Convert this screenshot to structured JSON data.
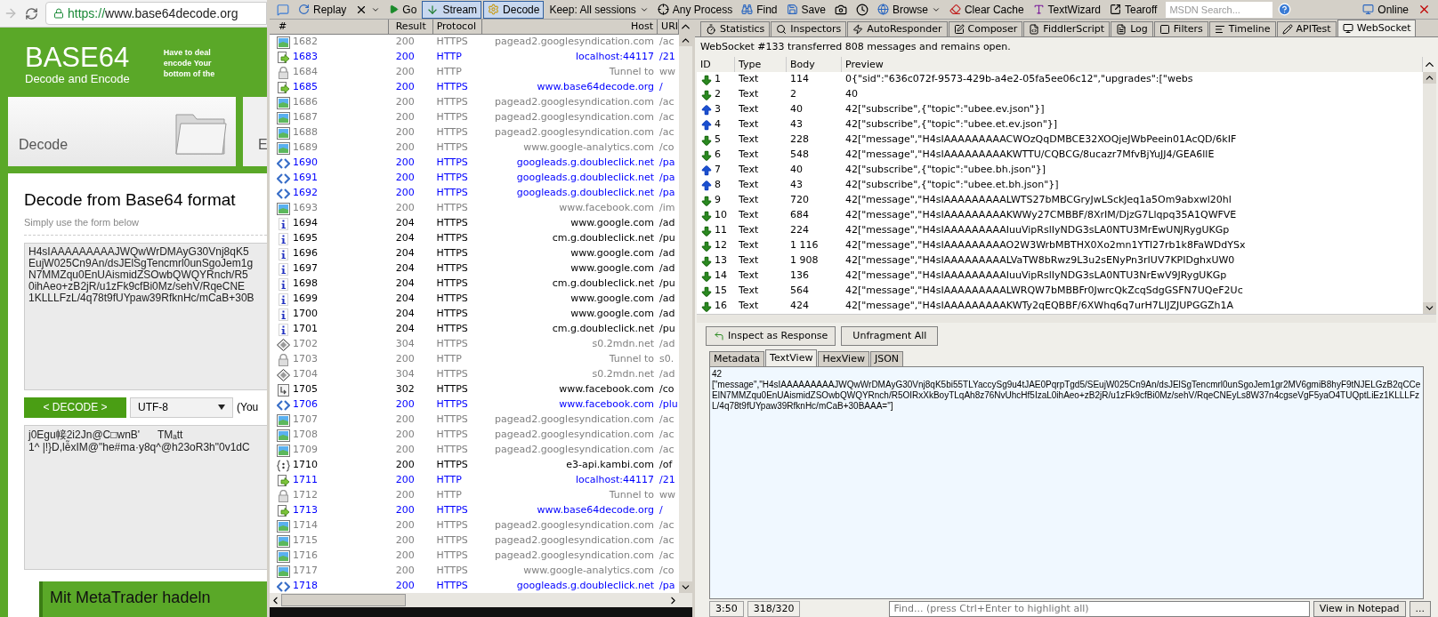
{
  "browser": {
    "url": "https://www.base64decode.org",
    "logo_title": "BASE64",
    "logo_subtitle": "Decode and Encode",
    "intro_lines": [
      "Have to deal",
      "encode Your",
      "bottom of the"
    ],
    "cards": [
      {
        "label": "Decode",
        "selected": true
      },
      {
        "label": "E",
        "selected": false
      }
    ],
    "heading": "Decode from Base64 format",
    "subheading": "Simply use the form below",
    "input_lines": [
      "H4sIAAAAAAAAAJWQwWrDMAyG30Vnj8qK5",
      "EujW025Cn9An/dsJElSgTencmrl0unSgoJem1g",
      "N7MMZqu0EnUAismidZSOwbQWQYRnch/R5",
      "0ihAeo+zB2jR/u1zFk9cfBi0Mz/sehV/RqeCNE",
      "1KLLLFzL/4q78t9fUYpaw39RfknHc/mCaB+30B"
    ],
    "decode_button": "< DECODE >",
    "charset": "UTF-8",
    "charset_note": "(You",
    "output_lines": [
      "j0Egu帹2i2Jn@C□wnB'      TMₐtt",
      "1^ |!}D,lễxIM@\"he#ma·y8q^@h23oR3h\"0v1dC"
    ],
    "banner": "Mit MetaTrader hadeln"
  },
  "toolbar": {
    "replay": "Replay",
    "go": "Go",
    "stream": {
      "label": "Stream",
      "on": true
    },
    "decode": {
      "label": "Decode",
      "on": true
    },
    "keep": "Keep: All sessions",
    "process": "Any Process",
    "find": "Find",
    "save": "Save",
    "browse": "Browse",
    "clear_cache": "Clear Cache",
    "text_wizard": "TextWizard",
    "tearoff": "Tearoff",
    "search_placeholder": "MSDN Search...",
    "online": "Online"
  },
  "sessions": {
    "columns": [
      "#",
      "Result",
      "Protocol",
      "Host",
      "URI"
    ],
    "rows": [
      {
        "num": "1682",
        "result": "200",
        "protocol": "HTTPS",
        "host": "pagead2.googlesyndication.com",
        "url": "/ac",
        "kind": "image",
        "color": "#808080"
      },
      {
        "num": "1683",
        "result": "200",
        "protocol": "HTTP",
        "host": "localhost:44117",
        "url": "/21",
        "kind": "script",
        "color": "#0000ff"
      },
      {
        "num": "1684",
        "result": "200",
        "protocol": "HTTP",
        "host": "Tunnel to",
        "url": "ww",
        "kind": "lock",
        "color": "#808080"
      },
      {
        "num": "1685",
        "result": "200",
        "protocol": "HTTPS",
        "host": "www.base64decode.org",
        "url": "/",
        "kind": "script",
        "color": "#0000ff"
      },
      {
        "num": "1686",
        "result": "200",
        "protocol": "HTTPS",
        "host": "pagead2.googlesyndication.com",
        "url": "/ac",
        "kind": "image",
        "color": "#808080"
      },
      {
        "num": "1687",
        "result": "200",
        "protocol": "HTTPS",
        "host": "pagead2.googlesyndication.com",
        "url": "/ac",
        "kind": "image",
        "color": "#808080"
      },
      {
        "num": "1688",
        "result": "200",
        "protocol": "HTTPS",
        "host": "pagead2.googlesyndication.com",
        "url": "/ac",
        "kind": "image",
        "color": "#808080"
      },
      {
        "num": "1689",
        "result": "200",
        "protocol": "HTTPS",
        "host": "www.google-analytics.com",
        "url": "/co",
        "kind": "image",
        "color": "#808080"
      },
      {
        "num": "1690",
        "result": "200",
        "protocol": "HTTPS",
        "host": "googleads.g.doubleclick.net",
        "url": "/pa",
        "kind": "html",
        "color": "#0000ff"
      },
      {
        "num": "1691",
        "result": "200",
        "protocol": "HTTPS",
        "host": "googleads.g.doubleclick.net",
        "url": "/pa",
        "kind": "html",
        "color": "#0000ff"
      },
      {
        "num": "1692",
        "result": "200",
        "protocol": "HTTPS",
        "host": "googleads.g.doubleclick.net",
        "url": "/pa",
        "kind": "html",
        "color": "#0000ff"
      },
      {
        "num": "1693",
        "result": "200",
        "protocol": "HTTPS",
        "host": "www.facebook.com",
        "url": "/im",
        "kind": "image",
        "color": "#808080"
      },
      {
        "num": "1694",
        "result": "204",
        "protocol": "HTTPS",
        "host": "www.google.com",
        "url": "/ad",
        "kind": "info",
        "color": "#000000"
      },
      {
        "num": "1695",
        "result": "204",
        "protocol": "HTTPS",
        "host": "cm.g.doubleclick.net",
        "url": "/pu",
        "kind": "info",
        "color": "#000000"
      },
      {
        "num": "1696",
        "result": "204",
        "protocol": "HTTPS",
        "host": "www.google.com",
        "url": "/ad",
        "kind": "info",
        "color": "#000000"
      },
      {
        "num": "1697",
        "result": "204",
        "protocol": "HTTPS",
        "host": "www.google.com",
        "url": "/ad",
        "kind": "info",
        "color": "#000000"
      },
      {
        "num": "1698",
        "result": "204",
        "protocol": "HTTPS",
        "host": "cm.g.doubleclick.net",
        "url": "/pu",
        "kind": "info",
        "color": "#000000"
      },
      {
        "num": "1699",
        "result": "204",
        "protocol": "HTTPS",
        "host": "www.google.com",
        "url": "/ad",
        "kind": "info",
        "color": "#000000"
      },
      {
        "num": "1700",
        "result": "204",
        "protocol": "HTTPS",
        "host": "www.google.com",
        "url": "/ad",
        "kind": "info",
        "color": "#000000"
      },
      {
        "num": "1701",
        "result": "204",
        "protocol": "HTTPS",
        "host": "cm.g.doubleclick.net",
        "url": "/pu",
        "kind": "info",
        "color": "#000000"
      },
      {
        "num": "1702",
        "result": "304",
        "protocol": "HTTPS",
        "host": "s0.2mdn.net",
        "url": "/ad",
        "kind": "cache",
        "color": "#808080"
      },
      {
        "num": "1703",
        "result": "200",
        "protocol": "HTTP",
        "host": "Tunnel to",
        "url": "s0.",
        "kind": "lock",
        "color": "#808080"
      },
      {
        "num": "1704",
        "result": "304",
        "protocol": "HTTPS",
        "host": "s0.2mdn.net",
        "url": "/ad",
        "kind": "cache",
        "color": "#808080"
      },
      {
        "num": "1705",
        "result": "302",
        "protocol": "HTTPS",
        "host": "www.facebook.com",
        "url": "/co",
        "kind": "redirect",
        "color": "#000000"
      },
      {
        "num": "1706",
        "result": "200",
        "protocol": "HTTPS",
        "host": "www.facebook.com",
        "url": "/plu",
        "kind": "html",
        "color": "#0000ff"
      },
      {
        "num": "1707",
        "result": "200",
        "protocol": "HTTPS",
        "host": "pagead2.googlesyndication.com",
        "url": "/ac",
        "kind": "image",
        "color": "#808080"
      },
      {
        "num": "1708",
        "result": "200",
        "protocol": "HTTPS",
        "host": "pagead2.googlesyndication.com",
        "url": "/ac",
        "kind": "image",
        "color": "#808080"
      },
      {
        "num": "1709",
        "result": "200",
        "protocol": "HTTPS",
        "host": "pagead2.googlesyndication.com",
        "url": "/ac",
        "kind": "image",
        "color": "#808080"
      },
      {
        "num": "1710",
        "result": "200",
        "protocol": "HTTPS",
        "host": "e3-api.kambi.com",
        "url": "/of",
        "kind": "json",
        "color": "#000000"
      },
      {
        "num": "1711",
        "result": "200",
        "protocol": "HTTP",
        "host": "localhost:44117",
        "url": "/21",
        "kind": "script",
        "color": "#0000ff"
      },
      {
        "num": "1712",
        "result": "200",
        "protocol": "HTTP",
        "host": "Tunnel to",
        "url": "ww",
        "kind": "lock",
        "color": "#808080"
      },
      {
        "num": "1713",
        "result": "200",
        "protocol": "HTTPS",
        "host": "www.base64decode.org",
        "url": "/",
        "kind": "script",
        "color": "#0000ff"
      },
      {
        "num": "1714",
        "result": "200",
        "protocol": "HTTPS",
        "host": "pagead2.googlesyndication.com",
        "url": "/ac",
        "kind": "image",
        "color": "#808080"
      },
      {
        "num": "1715",
        "result": "200",
        "protocol": "HTTPS",
        "host": "pagead2.googlesyndication.com",
        "url": "/ac",
        "kind": "image",
        "color": "#808080"
      },
      {
        "num": "1716",
        "result": "200",
        "protocol": "HTTPS",
        "host": "pagead2.googlesyndication.com",
        "url": "/ac",
        "kind": "image",
        "color": "#808080"
      },
      {
        "num": "1717",
        "result": "200",
        "protocol": "HTTPS",
        "host": "www.google-analytics.com",
        "url": "/co",
        "kind": "image",
        "color": "#808080"
      },
      {
        "num": "1718",
        "result": "200",
        "protocol": "HTTPS",
        "host": "googleads.g.doubleclick.net",
        "url": "/pa",
        "kind": "html",
        "color": "#0000ff"
      }
    ]
  },
  "inspector": {
    "tabs": [
      {
        "label": "Statistics",
        "selected": false
      },
      {
        "label": "Inspectors",
        "selected": false
      },
      {
        "label": "AutoResponder",
        "selected": false
      },
      {
        "label": "Composer",
        "selected": false
      },
      {
        "label": "FiddlerScript",
        "selected": false
      },
      {
        "label": "Log",
        "selected": false
      },
      {
        "label": "Filters",
        "selected": false
      },
      {
        "label": "Timeline",
        "selected": false
      },
      {
        "label": "APITest",
        "selected": false
      },
      {
        "label": "WebSocket",
        "selected": true
      }
    ],
    "caption": "WebSocket #133 transferred 808 messages and remains open.",
    "columns": [
      "ID",
      "Type",
      "Body",
      "Preview"
    ],
    "messages": [
      {
        "id": "1",
        "kind": "received",
        "type": "Text",
        "body": "114",
        "preview": "0{\"sid\":\"636c072f-9573-429b-a4e2-05fa5ee06c12\",\"upgrades\":[\"webs"
      },
      {
        "id": "2",
        "kind": "received",
        "type": "Text",
        "body": "2",
        "preview": "40"
      },
      {
        "id": "3",
        "kind": "sent",
        "type": "Text",
        "body": "40",
        "preview": "42[\"subscribe\",{\"topic\":\"ubee.ev.json\"}]"
      },
      {
        "id": "4",
        "kind": "sent",
        "type": "Text",
        "body": "43",
        "preview": "42[\"subscribe\",{\"topic\":\"ubee.et.ev.json\"}]"
      },
      {
        "id": "5",
        "kind": "received",
        "type": "Text",
        "body": "228",
        "preview": "42[\"message\",\"H4sIAAAAAAAAACWOzQqDMBCE32XOQjeJWbPeein01AcQD/6kIF"
      },
      {
        "id": "6",
        "kind": "received",
        "type": "Text",
        "body": "548",
        "preview": "42[\"message\",\"H4sIAAAAAAAAAKWTTU/CQBCG/8ucazr7MfvBjYuJJ4/GEA6llE"
      },
      {
        "id": "7",
        "kind": "sent",
        "type": "Text",
        "body": "40",
        "preview": "42[\"subscribe\",{\"topic\":\"ubee.bh.json\"}]"
      },
      {
        "id": "8",
        "kind": "sent",
        "type": "Text",
        "body": "43",
        "preview": "42[\"subscribe\",{\"topic\":\"ubee.et.bh.json\"}]"
      },
      {
        "id": "9",
        "kind": "received",
        "type": "Text",
        "body": "720",
        "preview": "42[\"message\",\"H4sIAAAAAAAAALWTS27bMBCGryJwLSckJeq1a5Om9abxwl20hl"
      },
      {
        "id": "10",
        "kind": "received",
        "type": "Text",
        "body": "684",
        "preview": "42[\"message\",\"H4sIAAAAAAAAAKWWy27CMBBF/8XrIM/DjzG7Llqpq35A1QWFVE"
      },
      {
        "id": "11",
        "kind": "received",
        "type": "Text",
        "body": "224",
        "preview": "42[\"message\",\"H4sIAAAAAAAAAIuuVipRslIyNDG3sLA0NTU3MrEwUNJRygUKGp"
      },
      {
        "id": "12",
        "kind": "received",
        "type": "Text",
        "body": "1 116",
        "preview": "42[\"message\",\"H4sIAAAAAAAAAO2W3WrbMBTHX0Xo2mn1YTl27rb1k8FaWDdYSx"
      },
      {
        "id": "13",
        "kind": "received",
        "type": "Text",
        "body": "1 908",
        "preview": "42[\"message\",\"H4sIAAAAAAAAALVaTW8bRwz9L3u2sENyPn3rIUV7KPIDghxUW0"
      },
      {
        "id": "14",
        "kind": "received",
        "type": "Text",
        "body": "136",
        "preview": "42[\"message\",\"H4sIAAAAAAAAAIuuVipRslIyNDG3sLA0NTU3NrEwV9JRygUKGp"
      },
      {
        "id": "15",
        "kind": "received",
        "type": "Text",
        "body": "564",
        "preview": "42[\"message\",\"H4sIAAAAAAAAALWRQW7bMBBFr0JwrcQkZcqSdgGSFN7UQeF2Uc"
      },
      {
        "id": "16",
        "kind": "received",
        "type": "Text",
        "body": "424",
        "preview": "42[\"message\",\"H4sIAAAAAAAAAKWTy2qEQBBF/6XWhq6q7urH7LIJZJUPGGZh1A"
      }
    ],
    "inspect_button": "Inspect as Response",
    "unfragment_button": "Unfragment All",
    "subtabs": [
      {
        "label": "Metadata",
        "selected": false
      },
      {
        "label": "TextView",
        "selected": true
      },
      {
        "label": "HexView",
        "selected": false
      },
      {
        "label": "JSON",
        "selected": false
      }
    ],
    "text_lines": [
      "42",
      "[\"message\",\"H4sIAAAAAAAAAJWQwWrDMAyG30Vnj8qK5bi55TLYaccySg9u4tJAE0PqrpTgd5/SEujW025Cn9An/dsJElSgTencmrl0unSgoJem1gr2MV6gmiB8hyF9tNJELGzB2qCCeElN7MMZqu0EnUAismidZSOwbQWQYRnch/R5OIRxXkBoyTLqAh8z76NvUhcHf5IzaL0ihAeo+zB2jR/u1zFk9cfBi0Mz/sehV/RqeCNEyLs8W37n4cgseVgF5yaO4TUQptLiEz1KLLLFzL/4q78t9fUYpaw39RfknHc/mCaB+30BAAA=\"]"
    ],
    "position": "3:50",
    "count": "318/320",
    "find_placeholder": "Find... (press Ctrl+Enter to highlight all)",
    "notepad_button": "View in Notepad",
    "more_button": "..."
  }
}
